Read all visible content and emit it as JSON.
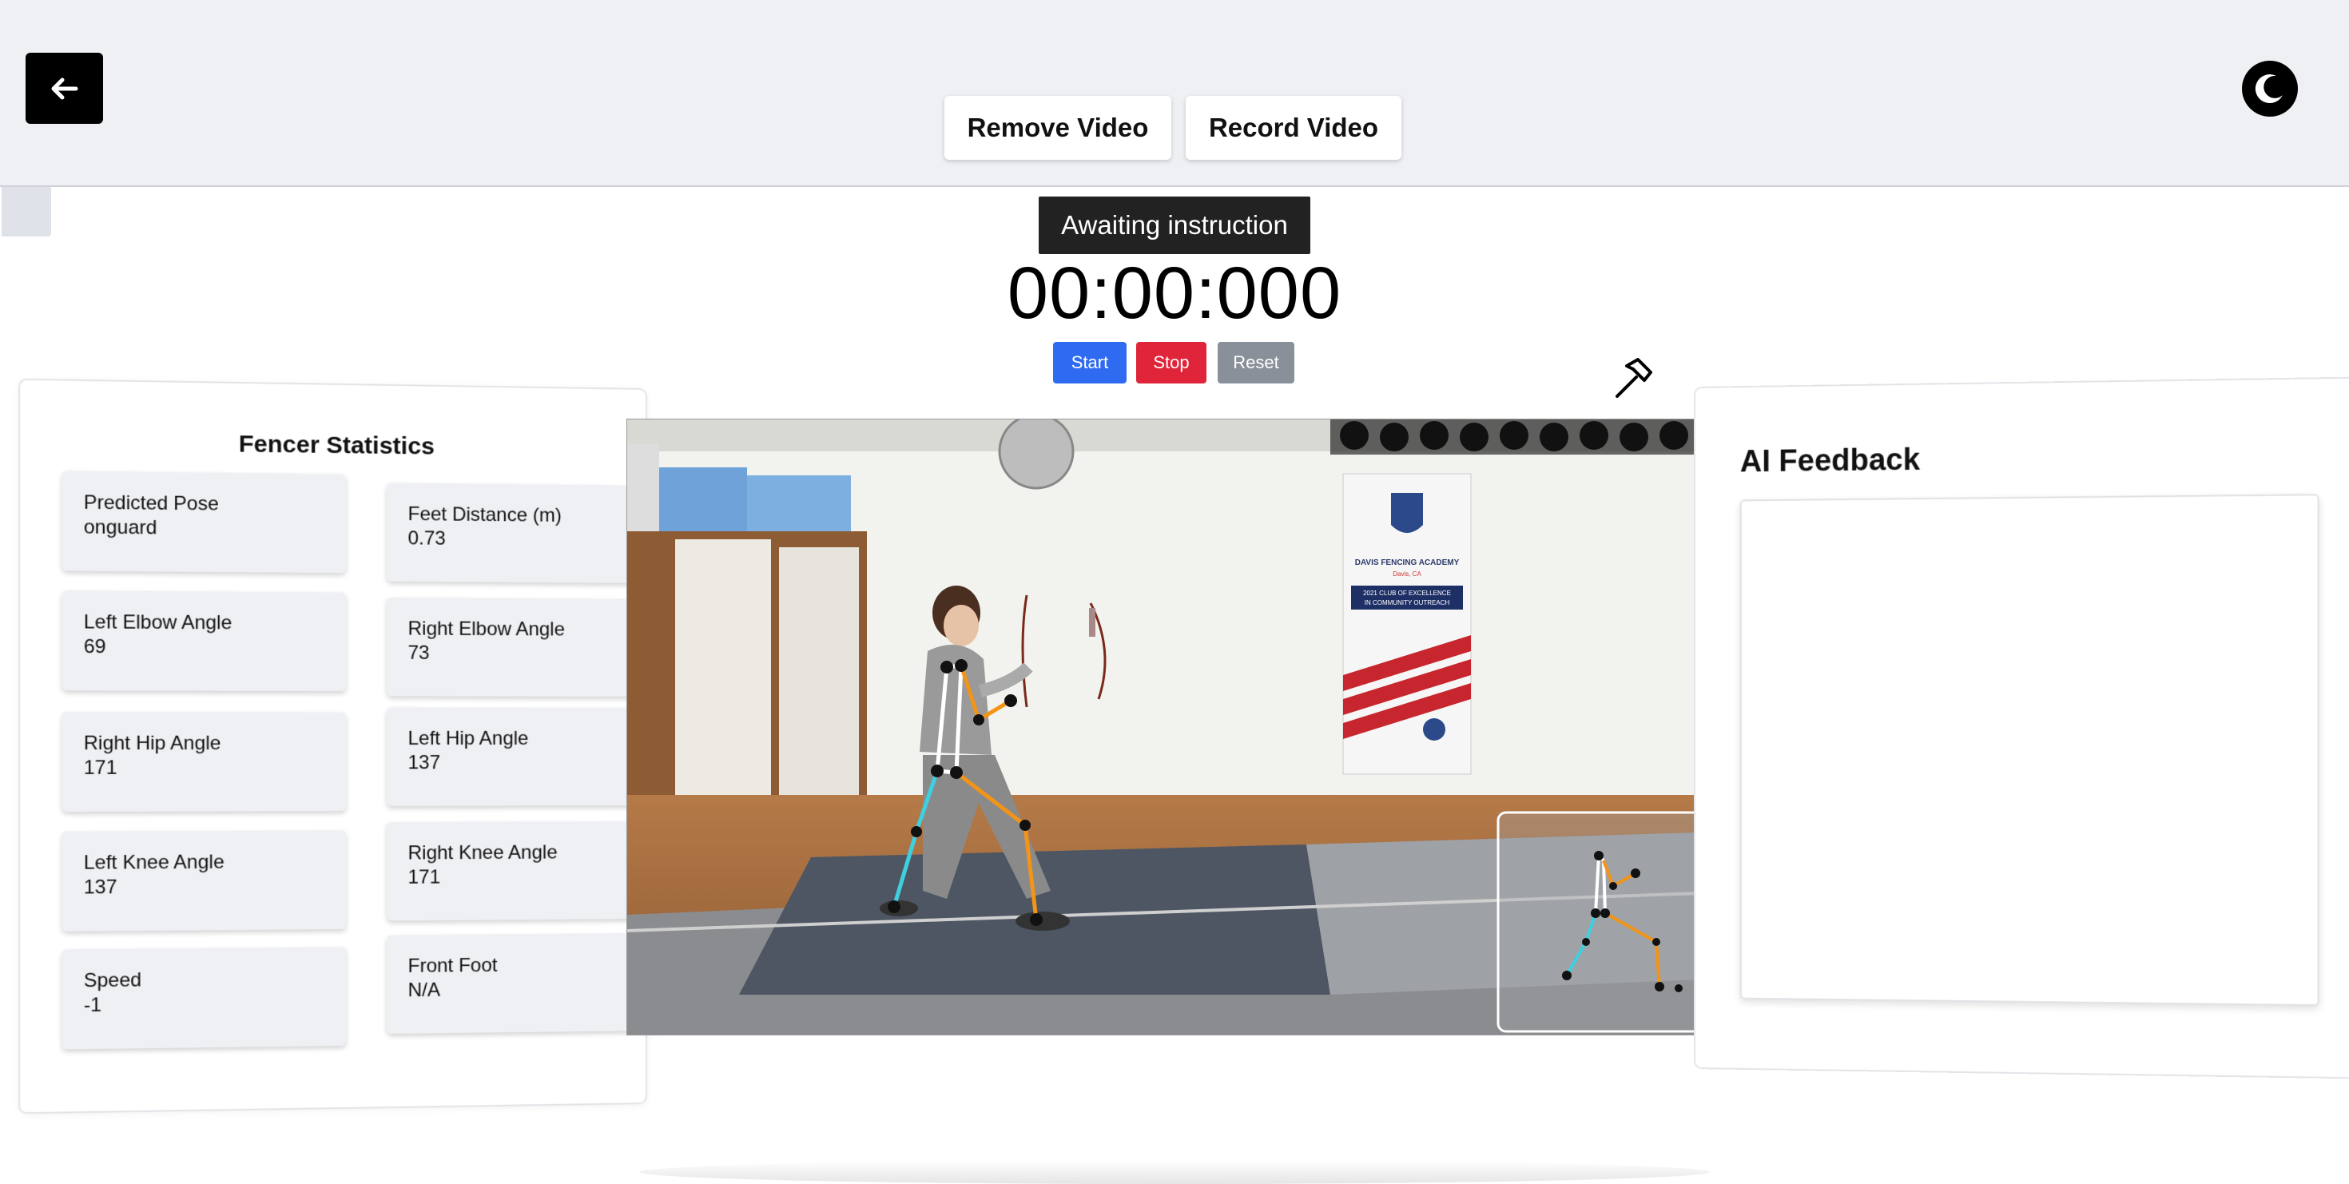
{
  "header": {
    "back_icon": "arrow-left-icon",
    "theme_icon": "moon-icon",
    "remove_video_label": "Remove Video",
    "record_video_label": "Record Video"
  },
  "status": {
    "message": "Awaiting instruction",
    "timer": "00:00:000"
  },
  "controls": {
    "start_label": "Start",
    "stop_label": "Stop",
    "reset_label": "Reset",
    "colors": {
      "start": "#2f6bf0",
      "stop": "#e0243a",
      "reset": "#8a9099"
    }
  },
  "stats": {
    "title": "Fencer Statistics",
    "cards": [
      {
        "label": "Predicted Pose",
        "value": "onguard"
      },
      {
        "label": "Feet Distance (m)",
        "value": "0.73"
      },
      {
        "label": "Left Elbow Angle",
        "value": "69"
      },
      {
        "label": "Right Elbow Angle",
        "value": "73"
      },
      {
        "label": "Right Hip Angle",
        "value": "171"
      },
      {
        "label": "Left Hip Angle",
        "value": "137"
      },
      {
        "label": "Left Knee Angle",
        "value": "137"
      },
      {
        "label": "Right Knee Angle",
        "value": "171"
      },
      {
        "label": "Speed",
        "value": "-1"
      },
      {
        "label": "Front Foot",
        "value": "N/A"
      }
    ]
  },
  "video": {
    "banner_title": "DAVIS FENCING ACADEMY",
    "banner_sub": "Davis, CA",
    "banner_line1": "2021 CLUB OF EXCELLENCE",
    "banner_line2": "IN COMMUNITY OUTREACH"
  },
  "feedback": {
    "title": "AI Feedback",
    "content": ""
  },
  "icons": {
    "tool": "hammer-icon"
  }
}
